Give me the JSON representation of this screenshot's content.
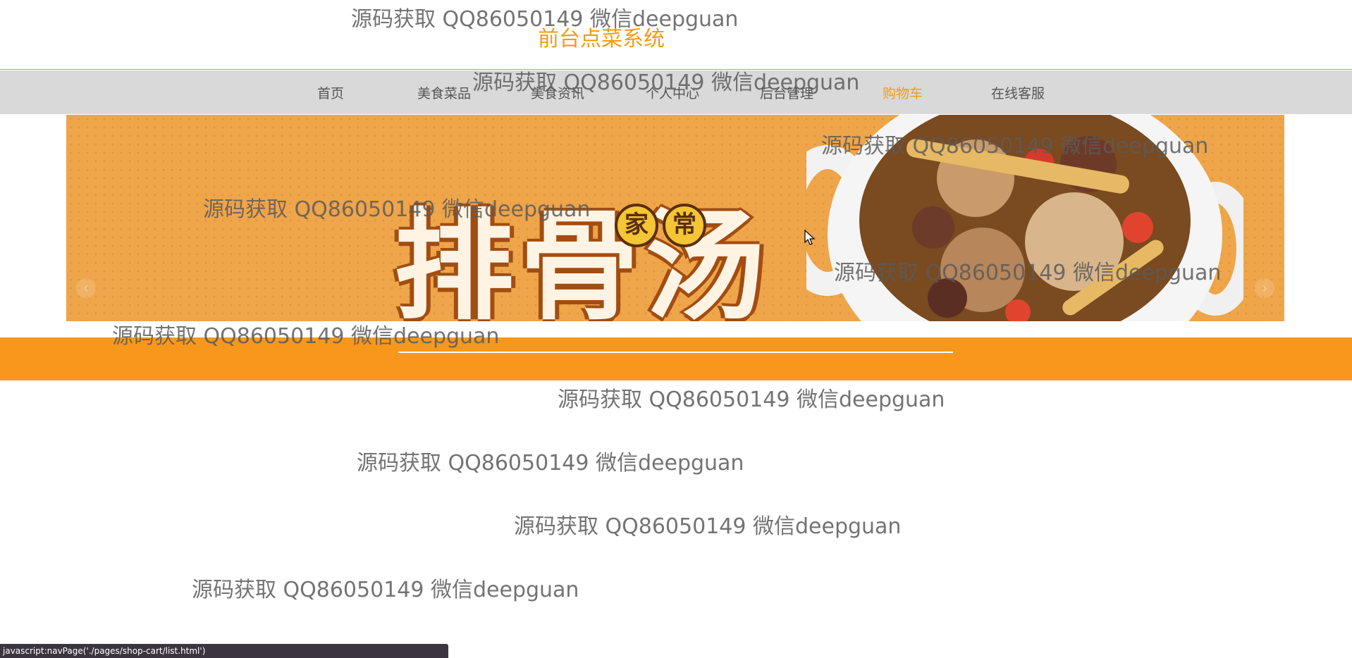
{
  "site": {
    "title": "前台点菜系统"
  },
  "nav": {
    "items": [
      {
        "label": "首页"
      },
      {
        "label": "美食菜品"
      },
      {
        "label": "美食资讯"
      },
      {
        "label": "个人中心"
      },
      {
        "label": "后台管理"
      },
      {
        "label": "购物车",
        "active": true
      },
      {
        "label": "在线客服"
      }
    ]
  },
  "banner": {
    "text": "排骨汤",
    "badge_1": "家",
    "badge_2": "常",
    "prev_arrow": "‹",
    "next_arrow": "›"
  },
  "watermark": {
    "text": "源码获取 QQ86050149 微信deepguan"
  },
  "status_bar": {
    "text": "javascript:navPage('./pages/shop-cart/list.html')"
  },
  "colors": {
    "accent": "#f39c12",
    "band": "#f7981c",
    "nav_bg": "#d9d9d9",
    "banner_bg": "#efa54a"
  },
  "icons": {
    "cursor": "mouse-pointer-icon",
    "prev": "chevron-left-icon",
    "next": "chevron-right-icon"
  }
}
